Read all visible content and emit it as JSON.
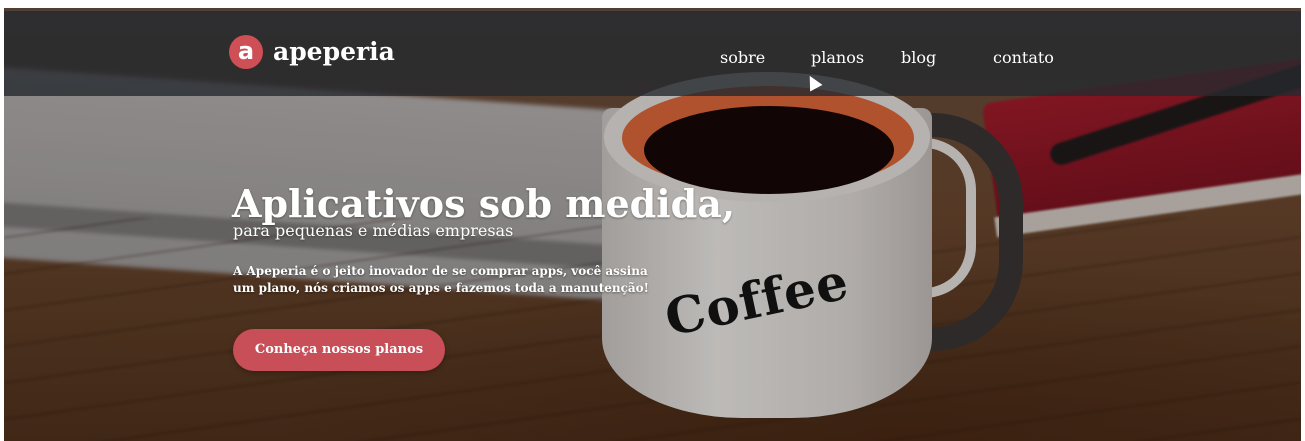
{
  "brand": {
    "logo_letter": "a",
    "name": "apeperia",
    "accent_color": "#c84e57"
  },
  "nav": {
    "links": [
      {
        "label": "sobre"
      },
      {
        "label": "planos"
      },
      {
        "label": "blog"
      },
      {
        "label": "contato"
      }
    ]
  },
  "hero": {
    "title": "Aplicativos sob medida,",
    "subtitle": "para pequenas e médias empresas",
    "description_line1": "A Apeperia é o jeito inovador de se comprar apps, você assina",
    "description_line2": "um plano, nós criamos os apps e fazemos toda a manutenção!",
    "cta_label": "Conheça nossos planos",
    "background_mug_text": "Coffee"
  },
  "icons": {
    "cursor": "mouse-pointer-icon"
  }
}
